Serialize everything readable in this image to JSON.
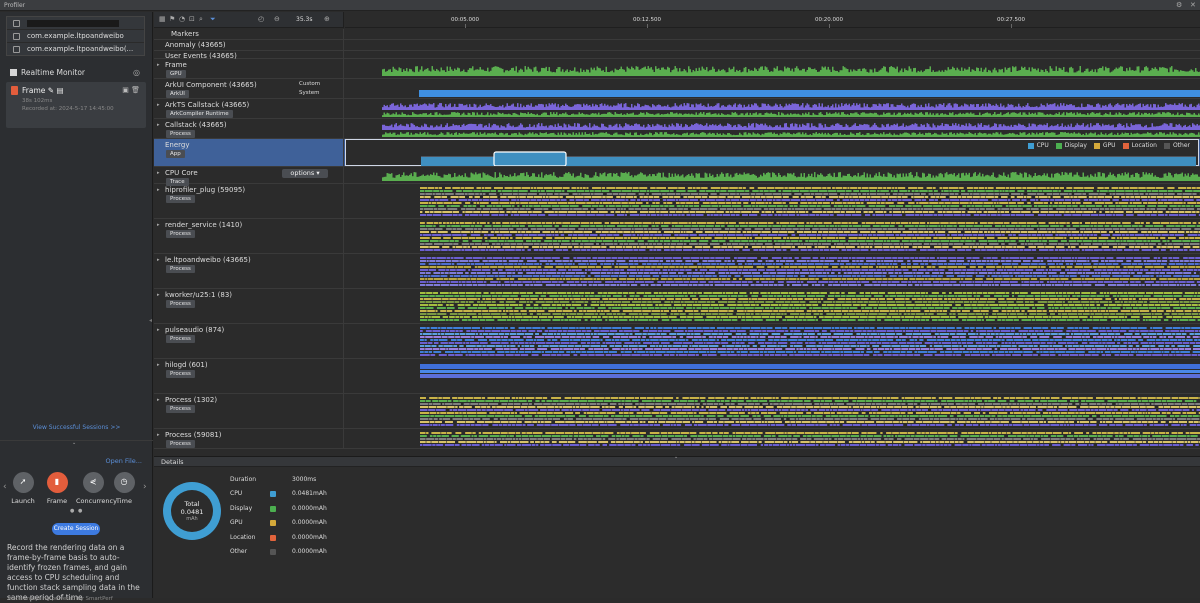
{
  "window": {
    "title": "Profiler",
    "controls": [
      "settings-icon",
      "close-icon"
    ]
  },
  "sidebar": {
    "devices": [
      {
        "label": "",
        "redacted": true
      },
      {
        "label": "com.example.ltpoandweibo"
      },
      {
        "label": "com.example.ltpoandweibo(..."
      }
    ],
    "realtime_monitor": "Realtime Monitor",
    "session": {
      "name": "Frame",
      "duration": "38s 102ms",
      "recorded": "Recorded at: 2024-5-17 14:45:00"
    },
    "view_sessions": "View Successful Sessions >>",
    "open_file": "Open File...",
    "modes": [
      {
        "label": "Launch",
        "icon": "rocket-icon",
        "selected": false
      },
      {
        "label": "Frame",
        "icon": "frame-icon",
        "selected": true
      },
      {
        "label": "Concurrency",
        "icon": "share-icon",
        "selected": false
      },
      {
        "label": "Time",
        "icon": "clock-icon",
        "selected": false
      }
    ],
    "create_session": "Create Session",
    "description": "Record the rendering data on a frame-by-frame basis to auto-identify frozen frames, and gain access to CPU scheduling and function stack sampling data in the same period of time",
    "powered_by": "Trace analysing powered by SmartPerf"
  },
  "toolbar": {
    "zoom": "35.3s"
  },
  "ruler": {
    "ticks": [
      "00:05.000",
      "00:12.500",
      "00:20.000",
      "00:27.500"
    ]
  },
  "lanes": [
    {
      "name": "Markers",
      "tag": "",
      "expand": false,
      "kind": "markers"
    },
    {
      "name": "Anomaly (43665)",
      "tag": "",
      "expand": false,
      "kind": "empty"
    },
    {
      "name": "User Events (43665)",
      "tag": "",
      "expand": false,
      "kind": "empty"
    },
    {
      "name": "Frame",
      "tag": "GPU",
      "expand": true,
      "kind": "green"
    },
    {
      "name": "ArkUI Component (43665)",
      "tag": "ArkUI",
      "expand": false,
      "kind": "blue",
      "side": [
        "Custom",
        "System"
      ]
    },
    {
      "name": "ArkTS Callstack (43665)",
      "tag": "ArkCompiler Runtime",
      "expand": true,
      "kind": "purplegreen"
    },
    {
      "name": "Callstack (43665)",
      "tag": "Process",
      "expand": true,
      "kind": "purplegreen"
    },
    {
      "name": "Energy",
      "tag": "App",
      "expand": false,
      "kind": "energy",
      "selected": true
    },
    {
      "name": "CPU Core",
      "tag": "Trace",
      "expand": true,
      "kind": "green",
      "options": "options ▾"
    },
    {
      "name": "hiprofiler_plug (59095)",
      "tag": "Process",
      "expand": true,
      "kind": "multi"
    },
    {
      "name": "render_service (1410)",
      "tag": "Process",
      "expand": true,
      "kind": "multi"
    },
    {
      "name": "le.ltpoandweibo (43665)",
      "tag": "Process",
      "expand": true,
      "kind": "multi2"
    },
    {
      "name": "kworker/u25:1 (83)",
      "tag": "Process",
      "expand": true,
      "kind": "multi3"
    },
    {
      "name": "pulseaudio (874)",
      "tag": "Process",
      "expand": true,
      "kind": "multi4"
    },
    {
      "name": "hilogd (601)",
      "tag": "Process",
      "expand": true,
      "kind": "multi5"
    },
    {
      "name": "Process (1302)",
      "tag": "Process",
      "expand": true,
      "kind": "multi"
    },
    {
      "name": "Process (59081)",
      "tag": "Process",
      "expand": true,
      "kind": "multi"
    }
  ],
  "energy_legend": [
    {
      "label": "CPU",
      "color": "#3f9ed3"
    },
    {
      "label": "Display",
      "color": "#4caf50"
    },
    {
      "label": "GPU",
      "color": "#d4a93a"
    },
    {
      "label": "Location",
      "color": "#e2643c"
    },
    {
      "label": "Other",
      "color": "#555555"
    }
  ],
  "details": {
    "title": "Details",
    "total_label": "Total",
    "total_value": "0.0481",
    "total_unit": "mAh",
    "duration_label": "Duration",
    "duration_value": "3000ms",
    "rows": [
      {
        "label": "CPU",
        "value": "0.0481mAh",
        "color": "#3f9ed3"
      },
      {
        "label": "Display",
        "value": "0.0000mAh",
        "color": "#4caf50"
      },
      {
        "label": "GPU",
        "value": "0.0000mAh",
        "color": "#d4a93a"
      },
      {
        "label": "Location",
        "value": "0.0000mAh",
        "color": "#e2643c"
      },
      {
        "label": "Other",
        "value": "0.0000mAh",
        "color": "#555555"
      }
    ]
  }
}
